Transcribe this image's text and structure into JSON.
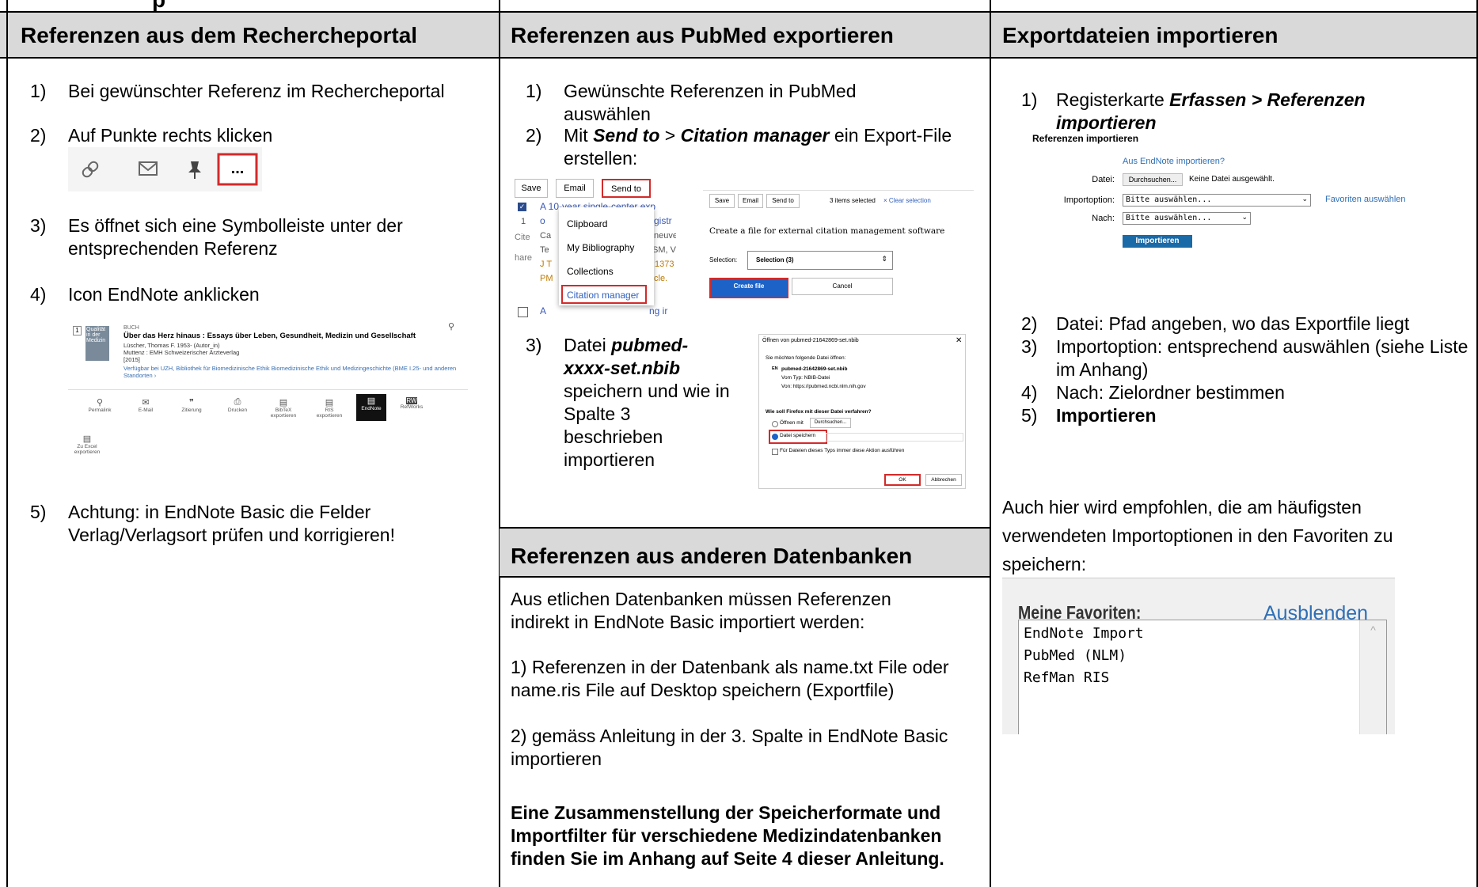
{
  "top_fragment": "p",
  "columns": {
    "col1": {
      "title": "Referenzen aus dem Rechercheportal",
      "steps": [
        {
          "n": "1)",
          "text": "Bei gewünschter Referenz im Rechercheportal"
        },
        {
          "n": "2)",
          "text": "Auf Punkte rechts klicken"
        },
        {
          "n": "3)",
          "text": "Es öffnet sich eine Symbolleiste unter der entsprechenden Referenz"
        },
        {
          "n": "4)",
          "text": "Icon EndNote anklicken"
        },
        {
          "n": "5)",
          "text": "Achtung: in EndNote Basic die Felder Verlag/Verlagsort prüfen und korrigieren!"
        }
      ],
      "record": {
        "num": "1",
        "cover": "Qualität in der Medizin",
        "type": "BUCH",
        "title": "Über das Herz hinaus : Essays über Leben, Gesundheit, Medizin und Gesellschaft",
        "author": "Lüscher, Thomas F. 1953- (Autor_in)",
        "publisher": "Muttenz : EMH Schweizerischer Ärzteverlag",
        "year": "[2015]",
        "availability": "Verfügbar bei UZH, Bibliothek für Biomedizinische Ethik Biomedizinische Ethik und Medizingeschichte (BME I.25- und anderen Standorten  ›",
        "toolbar": [
          "Permalink",
          "E-Mail",
          "Zitierung",
          "Drucken",
          "BibTeX exportieren",
          "RIS exportieren",
          "EndNote",
          "RefWorks"
        ],
        "extra": "Zu Excel exportieren"
      }
    },
    "col2": {
      "title": "Referenzen aus PubMed exportieren",
      "step1_n": "1)",
      "step1": "Gewünschte Referenzen in PubMed auswählen",
      "step2_n": "2)",
      "step2_pre": "Mit ",
      "step2_b1": "Send to",
      "step2_mid": " > ",
      "step2_b2": "Citation manager",
      "step2_post": " ein Export-File erstellen:",
      "step3_n": "3)",
      "step3_pre": "Datei ",
      "step3_b": "pubmed-xxxx-set.nbib",
      "step3_post": " speichern und wie in Spalte 3 beschrieben importieren",
      "pubmed_left": {
        "btn_save": "Save",
        "btn_email": "Email",
        "btn_send": "Send to",
        "menu": [
          "Clipboard",
          "My Bibliography",
          "Collections",
          "Citation manager"
        ],
        "bg_frags": [
          "A 10-year single-center exp",
          "1",
          "o",
          "gistr",
          "Cite",
          "Ca",
          "neuve",
          "hare",
          "Te",
          "SM, V",
          "J T",
          ":1373",
          "PM",
          "cle.",
          "A",
          "ng ir"
        ]
      },
      "pubmed_right": {
        "btn_save": "Save",
        "btn_email": "Email",
        "btn_send": "Send to",
        "selected": "3 items selected",
        "clear": "× Clear selection",
        "heading": "Create a file for external citation management software",
        "sel_label": "Selection:",
        "sel_value": "Selection (3)",
        "create": "Create file",
        "cancel": "Cancel"
      },
      "dialog": {
        "title": "Öffnen von pubmed-21642869-set.nbib",
        "intro": "Sie möchten folgende Datei öffnen:",
        "file": "pubmed-21642869-set.nbib",
        "type": "Vom Typ: NBIB-Datei",
        "from": "Von: https://pubmed.ncbi.nlm.nih.gov",
        "question": "Wie soll Firefox mit dieser Datei verfahren?",
        "open_with": "Öffnen mit",
        "browse": "Durchsuchen...",
        "save": "Datei speichern",
        "always": "Für Dateien dieses Typs immer diese Aktion ausführen",
        "ok": "OK",
        "cancel": "Abbrechen"
      },
      "section2_title": "Referenzen aus anderen Datenbanken",
      "section2_p1": "Aus etlichen Datenbanken müssen Referenzen indirekt in EndNote Basic importiert werden:",
      "section2_p2": "1) Referenzen in der Datenbank als name.txt File oder name.ris File auf Desktop speichern (Exportfile)",
      "section2_p3": "2) gemäss Anleitung in der 3. Spalte in EndNote Basic importieren",
      "section2_bold": "Eine Zusammenstellung der Speicherformate und Importfilter für verschiedene Medizindatenbanken finden Sie im Anhang auf Seite 4 dieser Anleitung."
    },
    "col3": {
      "title": "Exportdateien importieren",
      "step1_n": "1)",
      "step1_pre": "Registerkarte ",
      "step1_b": "Erfassen > Referenzen importieren",
      "form": {
        "heading": "Referenzen importieren",
        "link": "Aus EndNote importieren?",
        "datei_label": "Datei:",
        "browse": "Durchsuchen...",
        "nofile": "Keine Datei ausgewählt.",
        "option_label": "Importoption:",
        "option_value": "Bitte auswählen...",
        "fav_link": "Favoriten auswählen",
        "nach_label": "Nach:",
        "nach_value": "Bitte auswählen...",
        "import_btn": "Importieren"
      },
      "steps": [
        {
          "n": "2)",
          "text": "Datei: Pfad angeben, wo das Exportfile liegt"
        },
        {
          "n": "3)",
          "text": "Importoption: entsprechend auswählen (siehe Liste im Anhang)"
        },
        {
          "n": "4)",
          "text": "Nach: Zielordner bestimmen"
        },
        {
          "n": "5)",
          "text": "Importieren"
        }
      ],
      "note": "Auch hier wird empfohlen, die am häufigsten verwendeten Importoptionen in den Favoriten zu speichern:",
      "favorites": {
        "title": "Meine Favoriten:",
        "hide": "Ausblenden",
        "items": [
          "EndNote Import",
          "PubMed (NLM)",
          "RefMan RIS"
        ]
      }
    }
  }
}
